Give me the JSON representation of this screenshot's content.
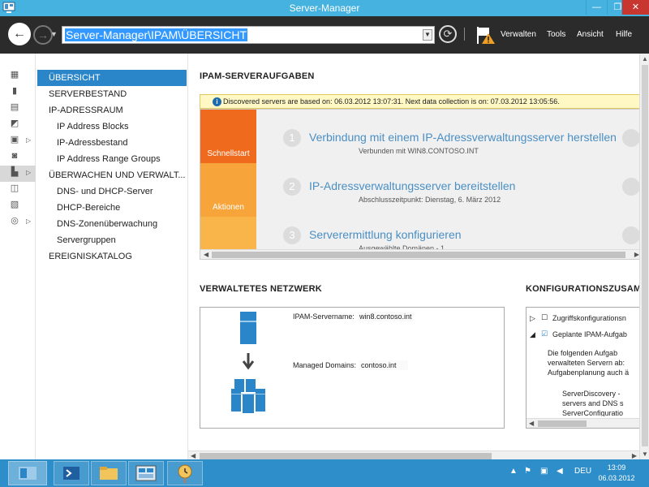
{
  "window": {
    "title": "Server-Manager",
    "min": "—",
    "max": "❐",
    "close": "✕"
  },
  "navbar": {
    "address": "Server-Manager\\IPAM\\ÜBERSICHT",
    "back_glyph": "←",
    "forward_glyph": "→",
    "refresh_glyph": "⟳",
    "menus": [
      "Verwalten",
      "Tools",
      "Ansicht",
      "Hilfe"
    ]
  },
  "tree": {
    "items": [
      {
        "label": "ÜBERSICHT",
        "level": 0,
        "selected": true
      },
      {
        "label": "SERVERBESTAND",
        "level": 0
      },
      {
        "label": "IP-ADRESSRAUM",
        "level": 0
      },
      {
        "label": "IP Address Blocks",
        "level": 1
      },
      {
        "label": "IP-Adressbestand",
        "level": 1
      },
      {
        "label": "IP Address Range Groups",
        "level": 1
      },
      {
        "label": "ÜBERWACHEN UND VERWALT...",
        "level": 0
      },
      {
        "label": "DNS- und DHCP-Server",
        "level": 1
      },
      {
        "label": "DHCP-Bereiche",
        "level": 1
      },
      {
        "label": "DNS-Zonenüberwachung",
        "level": 1
      },
      {
        "label": "Servergruppen",
        "level": 1
      },
      {
        "label": "EREIGNISKATALOG",
        "level": 0
      }
    ]
  },
  "tasks": {
    "title": "IPAM-SERVERAUFGABEN",
    "banner": "Discovered servers are based on: 06.03.2012 13:07:31. Next data collection is on: 07.03.2012 13:05:56.",
    "tabs": {
      "quick": "Schnellstart",
      "actions": "Aktionen"
    },
    "steps": [
      {
        "num": "1",
        "title": "Verbindung mit einem IP-Adressverwaltungsserver herstellen",
        "sub": "Verbunden mit WIN8.CONTOSO.INT"
      },
      {
        "num": "2",
        "title": "IP-Adressverwaltungsserver bereitstellen",
        "sub": "Abschlusszeitpunkt: Dienstag, 6. März 2012"
      },
      {
        "num": "3",
        "title": "Serverermittlung konfigurieren",
        "sub": "Ausgewählte Domänen - 1"
      }
    ]
  },
  "network": {
    "title": "VERWALTETES NETZWERK",
    "server_label": "IPAM-Servername:",
    "server_value": "win8.contoso.int",
    "domains_label": "Managed Domains:",
    "domains_value": "contoso.int"
  },
  "config": {
    "title": "KONFIGURATIONSZUSAM",
    "items": [
      "Zugriffskonfigurationsn",
      "Geplante IPAM-Aufgab"
    ],
    "text1": "Die folgenden Aufgab verwalteten Servern ab: Aufgabenplanung auch ä",
    "bullet1": "ServerDiscovery - servers and DNS s",
    "bullet2": "ServerConfiguratio"
  },
  "taskbar": {
    "lang": "DEU",
    "time": "13:09",
    "date": "06.03.2012"
  },
  "colors": {
    "titlebar": "#45b2df",
    "navbar": "#2b2b2b",
    "selected": "#2b86c9",
    "quickstart": "#f06a1e",
    "actions": "#f7a43a",
    "taskbar": "#2e8ec9"
  }
}
